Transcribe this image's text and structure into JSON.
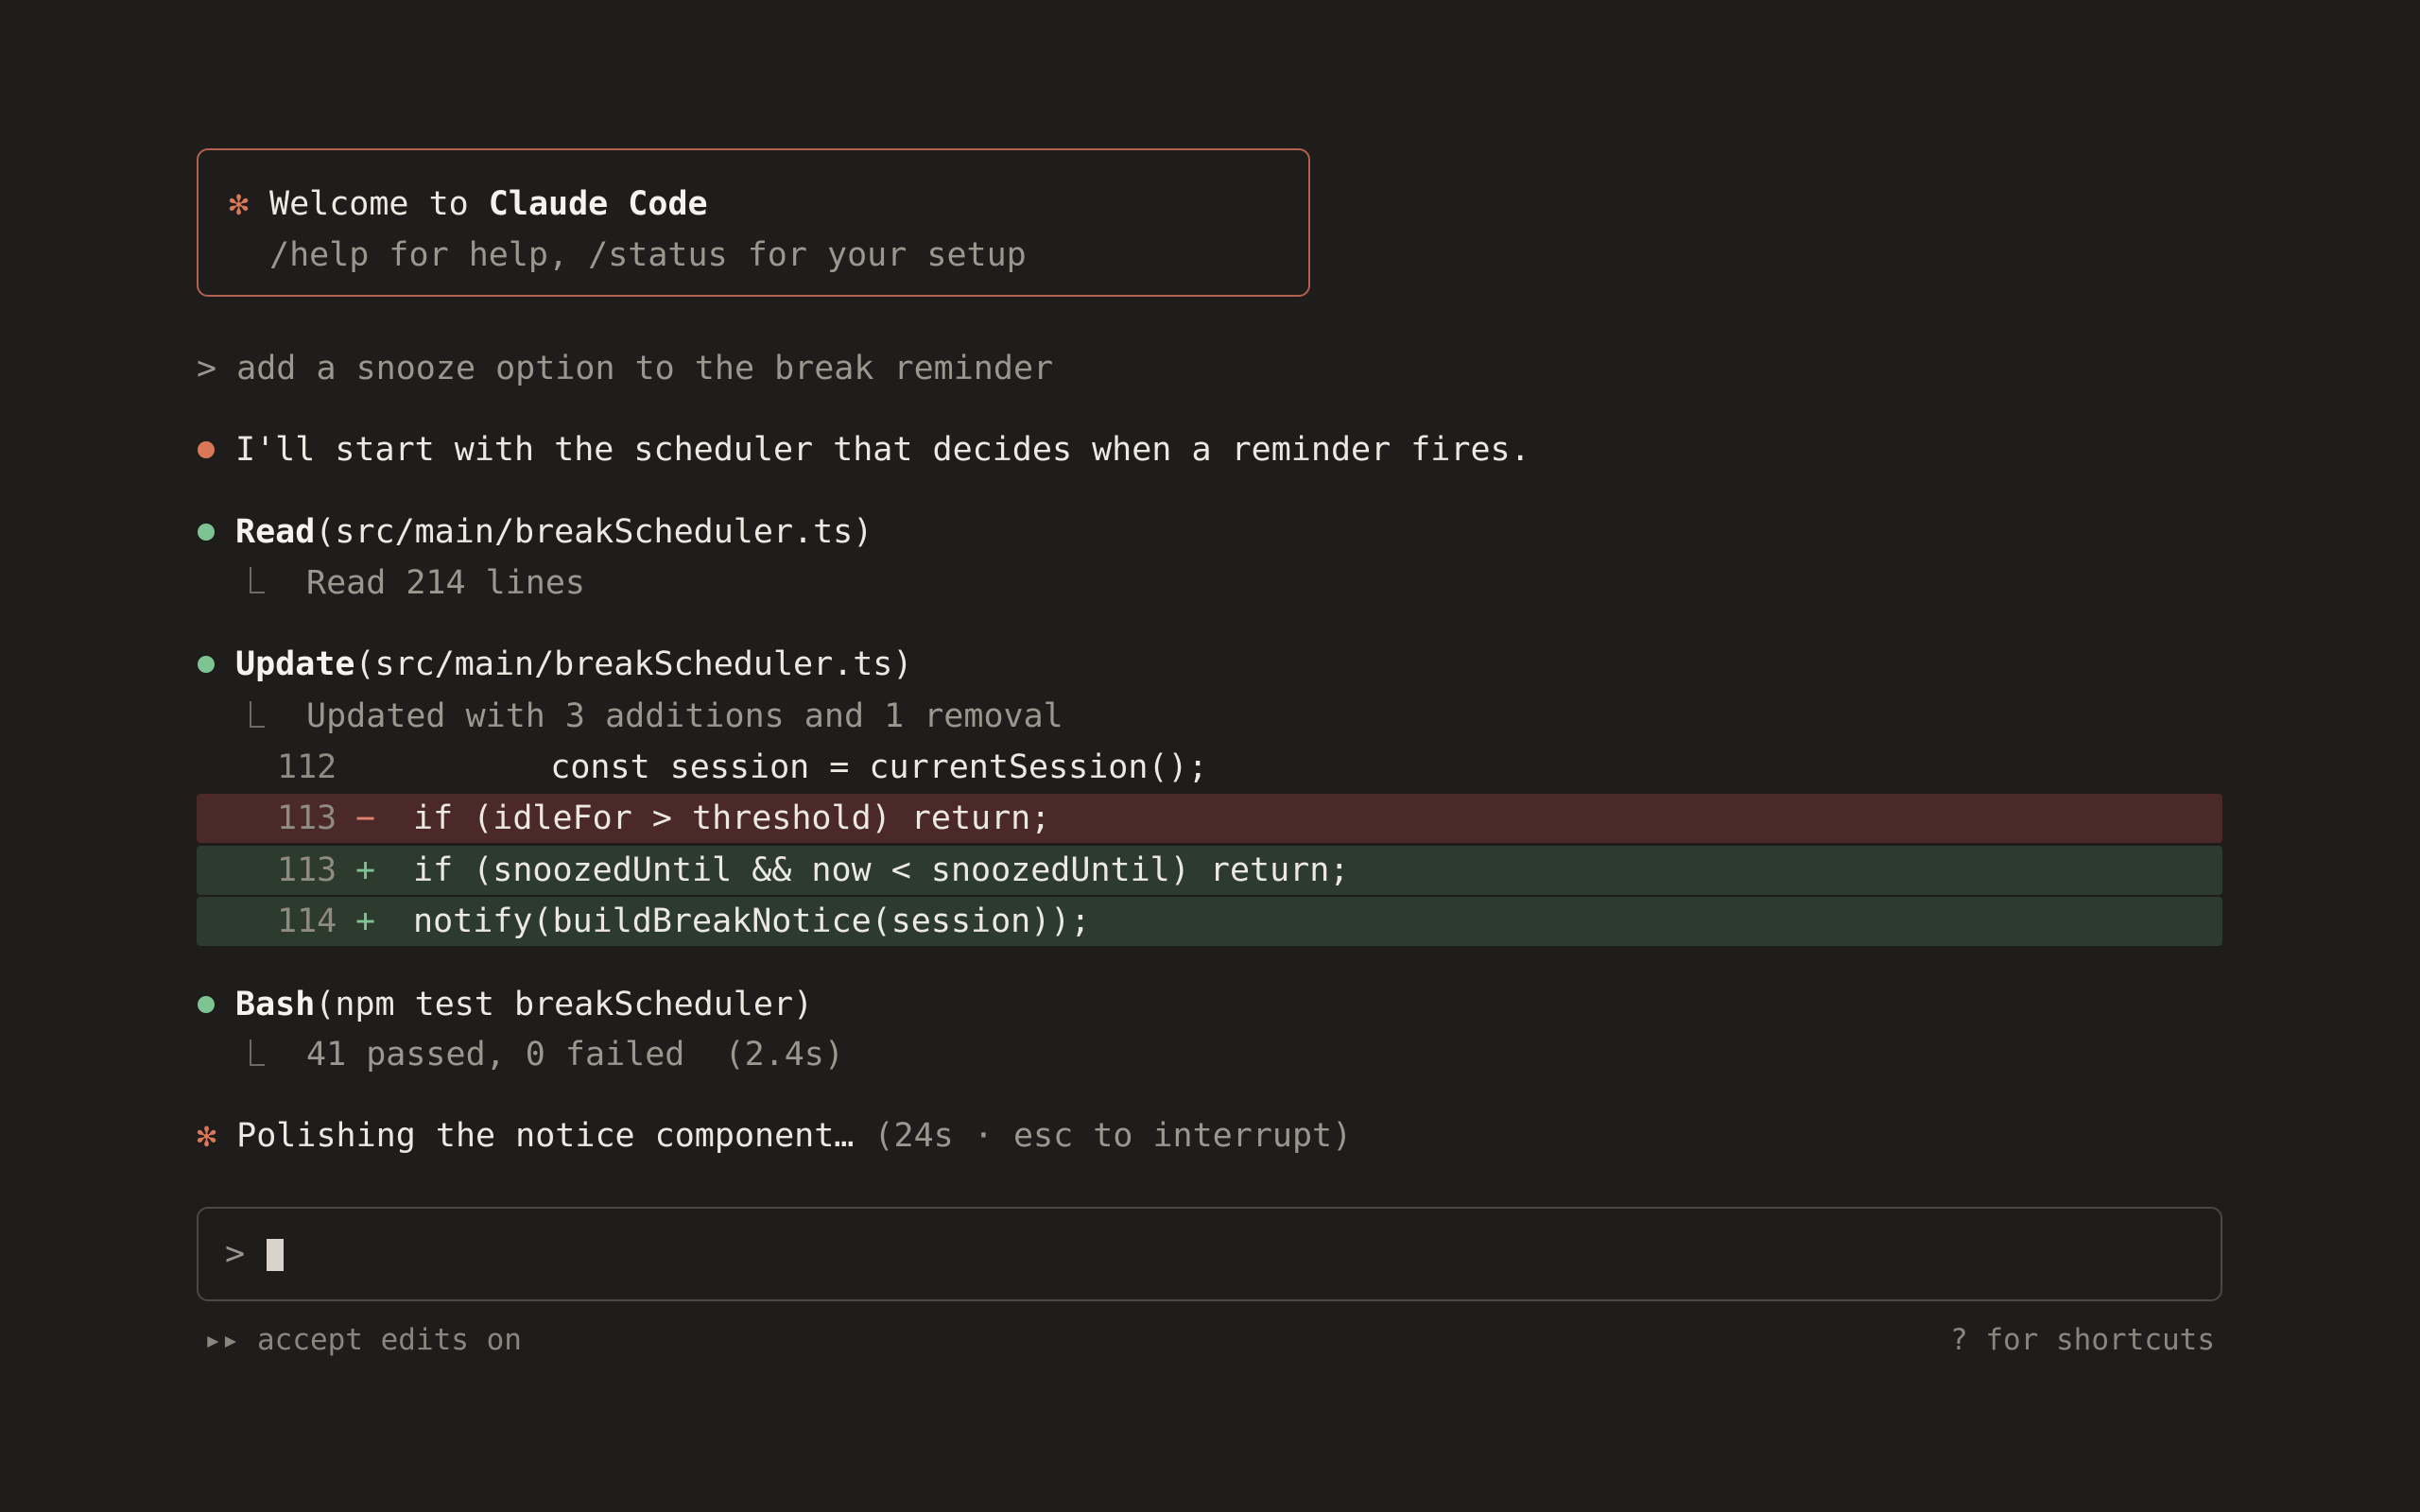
{
  "welcome": {
    "star": "✻",
    "prefix": "Welcome to ",
    "product": "Claude Code",
    "hint": "/help for help, /status for your setup"
  },
  "prompt": {
    "caret": ">",
    "text": "add a snooze option to the break reminder"
  },
  "assistant_message": "I'll start with the scheduler that decides when a reminder fires.",
  "tools": {
    "read": {
      "name": "Read",
      "arg": "(src/main/breakScheduler.ts)",
      "result": "Read 214 lines"
    },
    "update": {
      "name": "Update",
      "arg": "(src/main/breakScheduler.ts)",
      "result": "Updated with 3 additions and 1 removal"
    },
    "bash": {
      "name": "Bash",
      "arg": "(npm test breakScheduler)",
      "result": "41 passed, 0 failed  (2.4s)"
    }
  },
  "diff": [
    {
      "line": "112",
      "sign": "",
      "code": "    const session = currentSession();",
      "kind": "context"
    },
    {
      "line": "113",
      "sign": "−",
      "code": "if (idleFor > threshold) return;",
      "kind": "del"
    },
    {
      "line": "113",
      "sign": "+",
      "code": "if (snoozedUntil && now < snoozedUntil) return;",
      "kind": "add"
    },
    {
      "line": "114",
      "sign": "+",
      "code": "notify(buildBreakNotice(session));",
      "kind": "add"
    }
  ],
  "status": {
    "star": "✻",
    "text": "Polishing the notice component…",
    "detail": " (24s · esc to interrupt)"
  },
  "input": {
    "caret": ">"
  },
  "footer": {
    "left": "▸▸ accept edits on",
    "right": "? for shortcuts"
  },
  "colors": {
    "background": "#1e1d1c",
    "accent": "#d97757",
    "success": "#7ec492",
    "diff_del_bg": "#4a2928",
    "diff_add_bg": "#2d3b2f"
  }
}
